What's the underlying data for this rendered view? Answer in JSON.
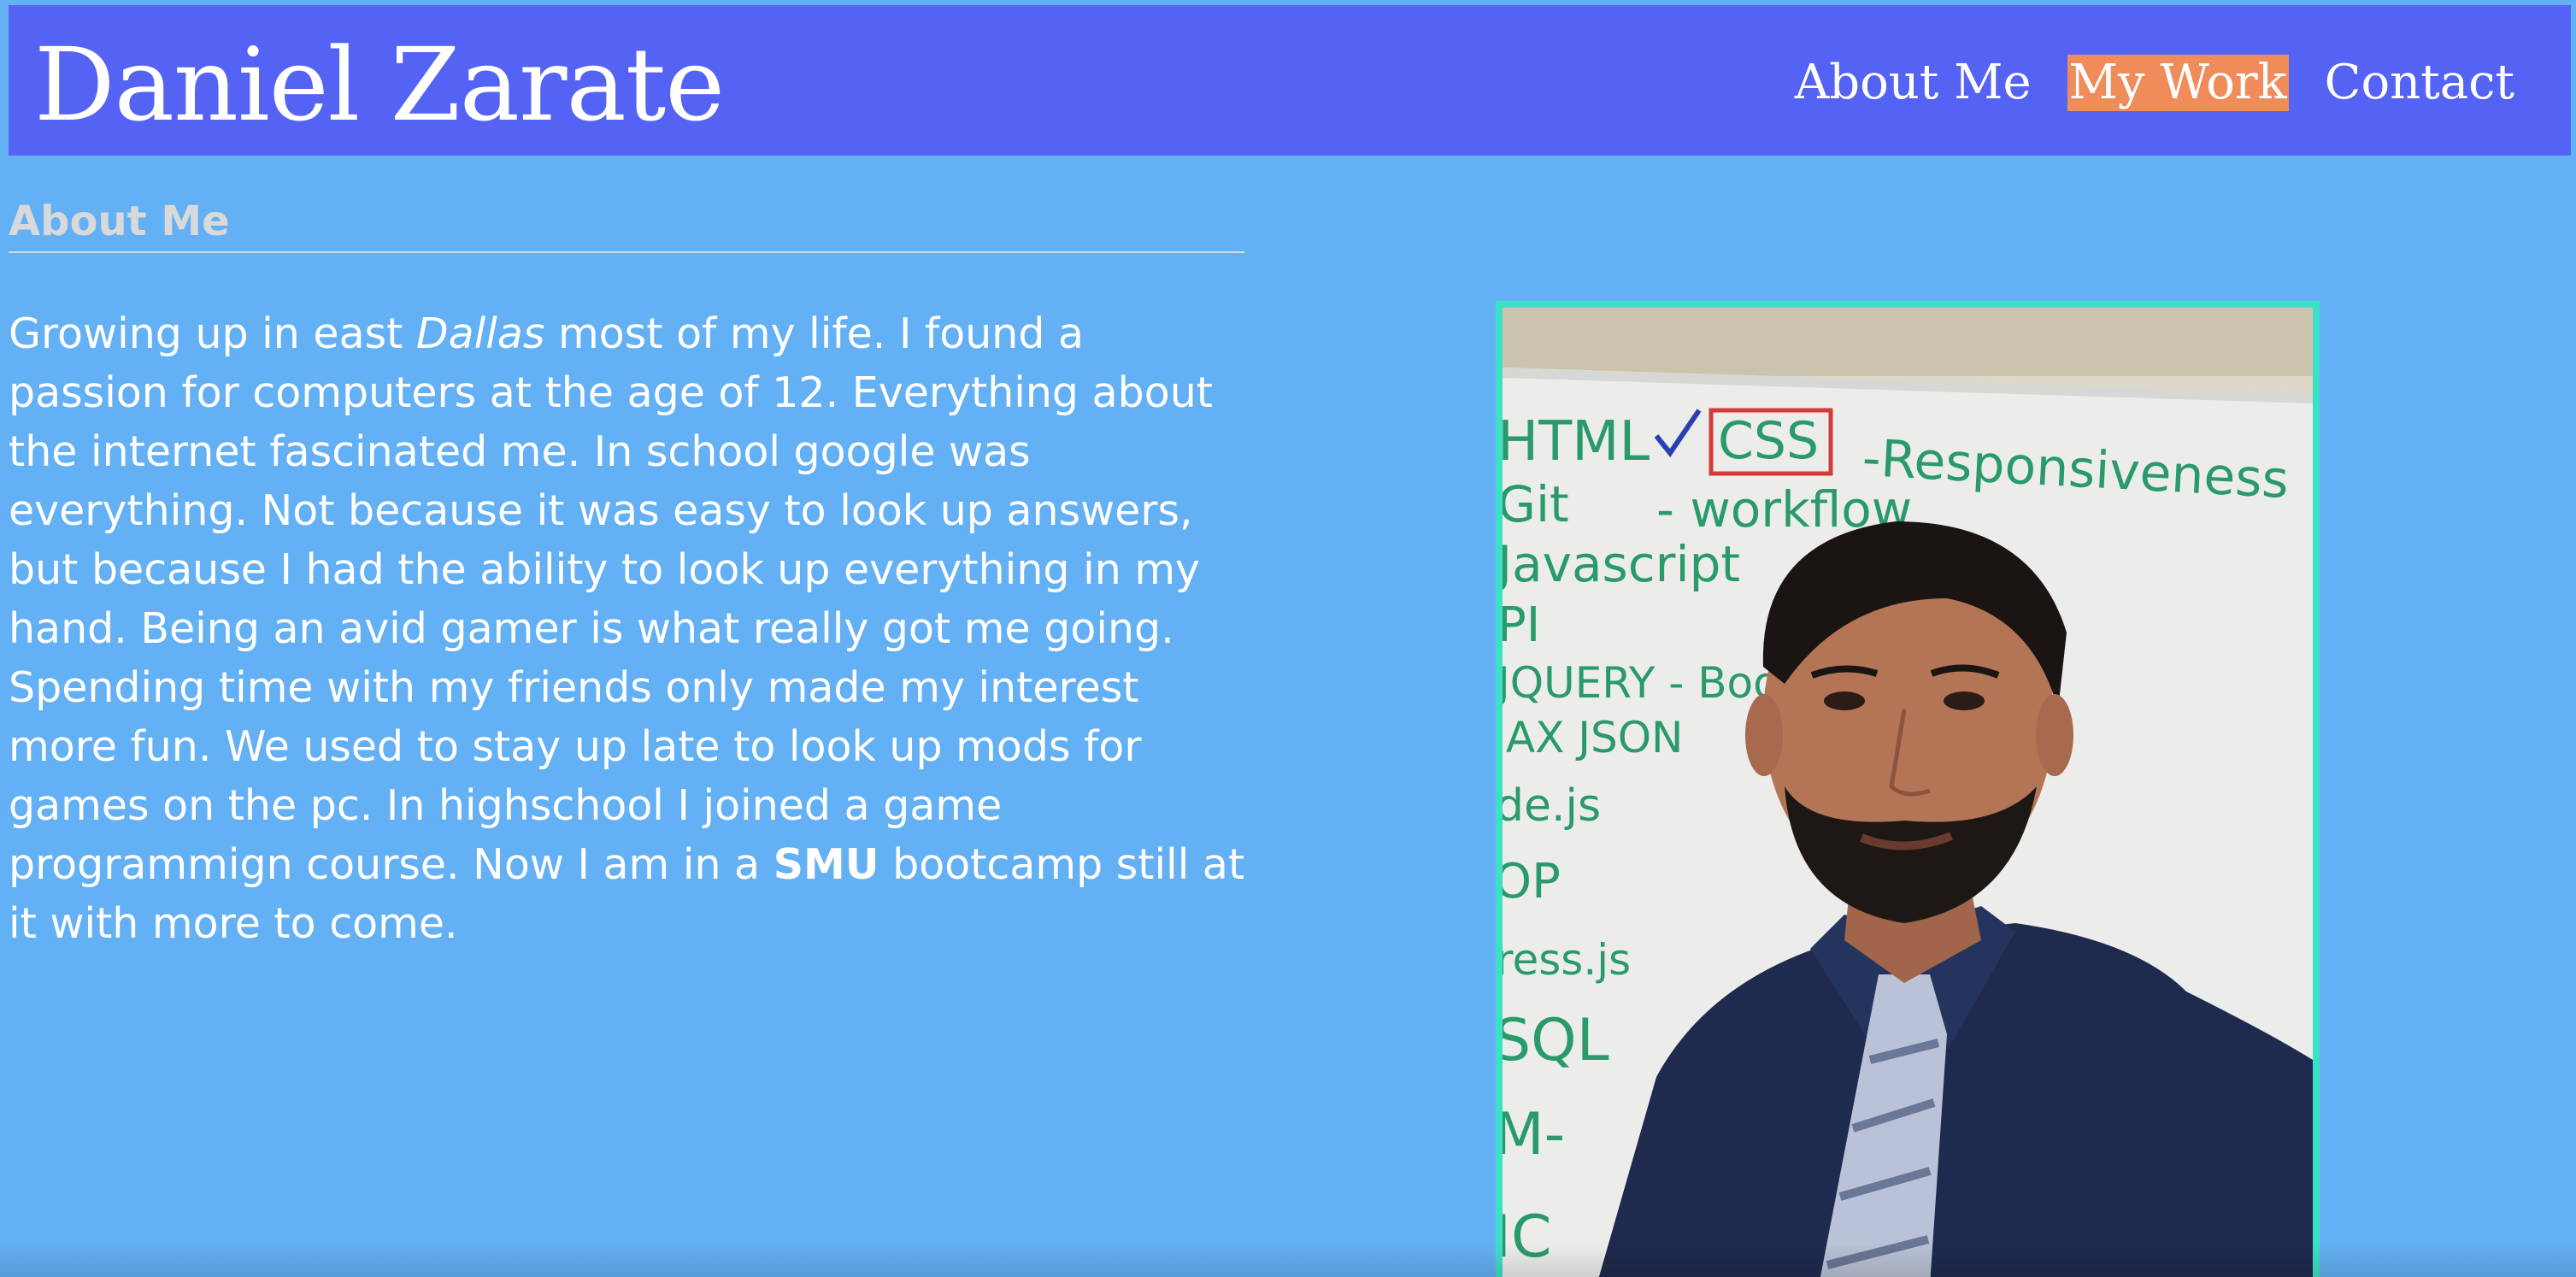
{
  "header": {
    "site_title": "Daniel Zarate",
    "nav": [
      {
        "label": "About Me",
        "active": false
      },
      {
        "label": "My Work",
        "active": true
      },
      {
        "label": "Contact",
        "active": false
      }
    ]
  },
  "about": {
    "heading": "About Me",
    "paragraph1": {
      "p1": "Growing up in east ",
      "em": "Dallas",
      "p2": " most of my life. I found a passion for computers at the age of 12. Everything about the internet fascinated me. In school google was everything. Not because it was easy to look up answers, but because I had the ability to look up everything in my hand. Being an avid gamer is what really got me going."
    },
    "paragraph2": {
      "p1": "Spending time with my friends only made my interest more fun. We used to stay up late to look up mods for games on the pc. In highschool I joined a game programmign course. Now I am in a ",
      "strong": "SMU",
      "p2": " bootcamp still at it with more to come."
    }
  },
  "photo": {
    "whiteboard_lines": [
      "HTML",
      "CSS",
      "-Responsiveness",
      "Git",
      "- workflow",
      "Javascript",
      "PI",
      "JQUERY - Boot",
      "JAX JSON",
      "de.js",
      "OP",
      "ress.js",
      "SQL",
      "M-",
      "IC"
    ],
    "colors": {
      "frame": "#3ce0c4",
      "marker_green": "#2a9a6a",
      "marker_red": "#d33a3a",
      "marker_blue": "#2a3fb0",
      "shirt": "#1e2a4e"
    }
  },
  "colors": {
    "page_bg": "#64b0f4",
    "header_bg": "#5563f4",
    "active_nav": "#ef8c5a",
    "heading_text": "#d9d9d9",
    "body_text": "#ffffff"
  }
}
